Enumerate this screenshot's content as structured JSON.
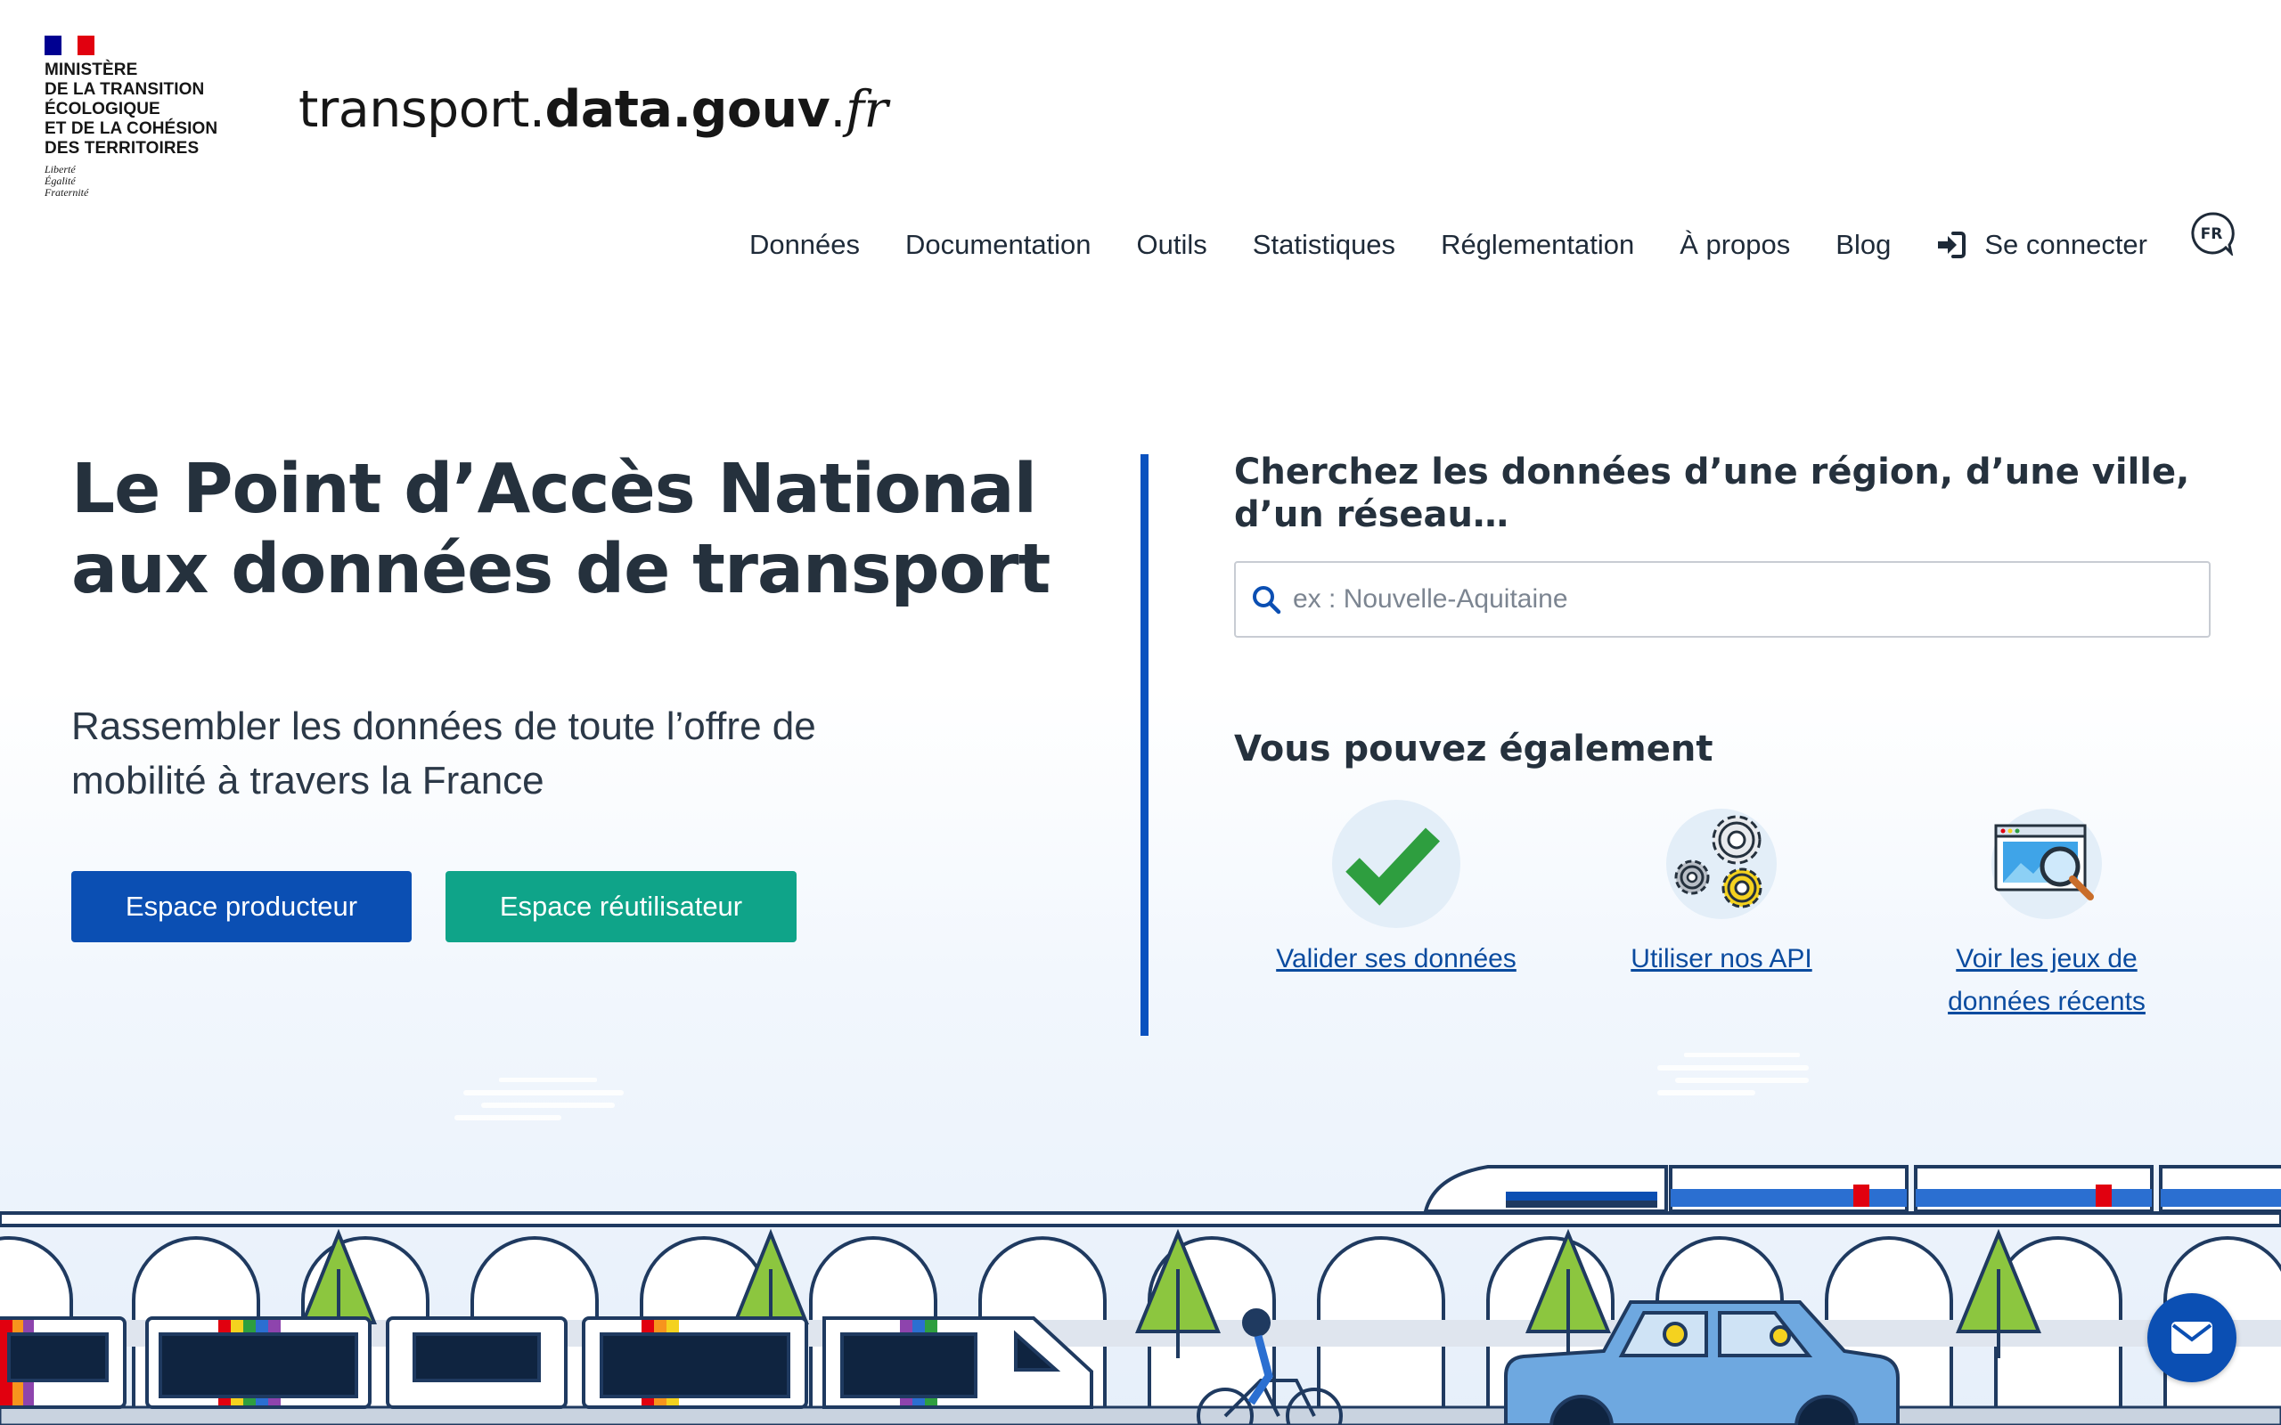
{
  "brand": {
    "ministry_lines": [
      "Ministère",
      "de la transition",
      "écologique",
      "et de la cohésion",
      "des territoires"
    ],
    "motto_lines": [
      "Liberté",
      "Égalité",
      "Fraternité"
    ],
    "site_title_part1": "transport.",
    "site_title_part2": "data.gouv",
    "site_title_part3": ".",
    "site_title_part4": "fr"
  },
  "nav": {
    "items": [
      "Données",
      "Documentation",
      "Outils",
      "Statistiques",
      "Réglementation",
      "À propos",
      "Blog"
    ],
    "login": "Se connecter",
    "language": "FR"
  },
  "hero": {
    "title_line1": "Le Point d’Accès National",
    "title_line2": "aux données de transport",
    "subtitle_line1": "Rassembler les données de toute l’offre de",
    "subtitle_line2": "mobilité à travers la France",
    "producer_button": "Espace producteur",
    "reuser_button": "Espace réutilisateur"
  },
  "search": {
    "title": "Cherchez les données d’une région, d’une ville, d’un réseau…",
    "placeholder": "ex : Nouvelle-Aquitaine",
    "value": ""
  },
  "also": {
    "title": "Vous pouvez également",
    "links": [
      {
        "label": "Valider ses données",
        "icon": "checkmark-icon"
      },
      {
        "label": "Utiliser nos API",
        "icon": "gears-icon"
      },
      {
        "label_line1": "Voir les jeux de",
        "label_line2": "données récents",
        "icon": "data-search-icon"
      }
    ]
  },
  "colors": {
    "primary_blue": "#0b4fb3",
    "green": "#0fa489",
    "text": "#25313d",
    "link": "#0a4b9f"
  }
}
